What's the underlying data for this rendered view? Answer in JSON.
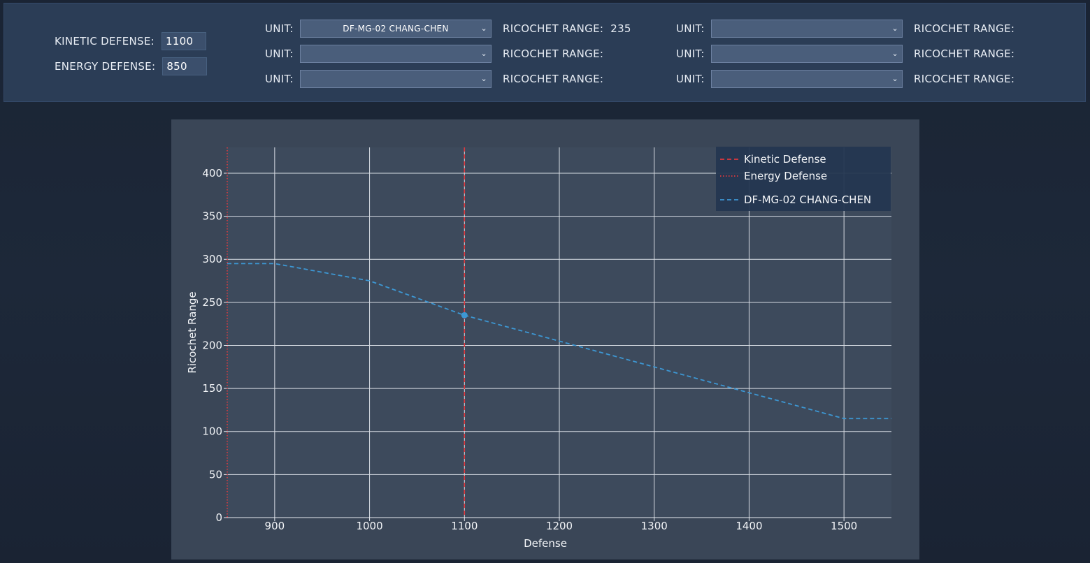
{
  "defense": {
    "kinetic_label": "KINETIC DEFENSE:",
    "kinetic_value": "1100",
    "energy_label": "ENERGY DEFENSE:",
    "energy_value": "850"
  },
  "units": [
    {
      "label": "UNIT:",
      "selected": "DF-MG-02 CHANG-CHEN",
      "range_label": "RICOCHET RANGE:",
      "range_value": "235"
    },
    {
      "label": "UNIT:",
      "selected": "",
      "range_label": "RICOCHET RANGE:",
      "range_value": ""
    },
    {
      "label": "UNIT:",
      "selected": "",
      "range_label": "RICOCHET RANGE:",
      "range_value": ""
    },
    {
      "label": "UNIT:",
      "selected": "",
      "range_label": "RICOCHET RANGE:",
      "range_value": ""
    },
    {
      "label": "UNIT:",
      "selected": "",
      "range_label": "RICOCHET RANGE:",
      "range_value": ""
    },
    {
      "label": "UNIT:",
      "selected": "",
      "range_label": "RICOCHET RANGE:",
      "range_value": ""
    }
  ],
  "icons": {
    "dropdown": "chevron-down-icon"
  },
  "colors": {
    "kinetic_line": "#e0393e",
    "energy_line": "#e0393e",
    "series_line": "#3d97d3",
    "grid": "#d8dde4",
    "legend_bg": "#243650"
  },
  "chart_data": {
    "type": "line",
    "title": "",
    "xlabel": "Defense",
    "ylabel": "Ricochet Range",
    "xlim": [
      850,
      1550
    ],
    "ylim": [
      0,
      430
    ],
    "xticks": [
      900,
      1000,
      1100,
      1200,
      1300,
      1400,
      1500
    ],
    "yticks": [
      0,
      50,
      100,
      150,
      200,
      250,
      300,
      350,
      400
    ],
    "grid": true,
    "legend_position": "top-right",
    "vlines": [
      {
        "name": "Kinetic Defense",
        "x": 1100,
        "style": "dashed"
      },
      {
        "name": "Energy Defense",
        "x": 850,
        "style": "dotted"
      }
    ],
    "series": [
      {
        "name": "DF-MG-02 CHANG-CHEN",
        "style": "dashed",
        "x": [
          850,
          900,
          1000,
          1100,
          1200,
          1300,
          1400,
          1500,
          1550
        ],
        "y": [
          295,
          295,
          275,
          235,
          205,
          175,
          145,
          115,
          115
        ]
      }
    ],
    "highlight_points": [
      {
        "x": 1100,
        "y": 235
      }
    ]
  }
}
